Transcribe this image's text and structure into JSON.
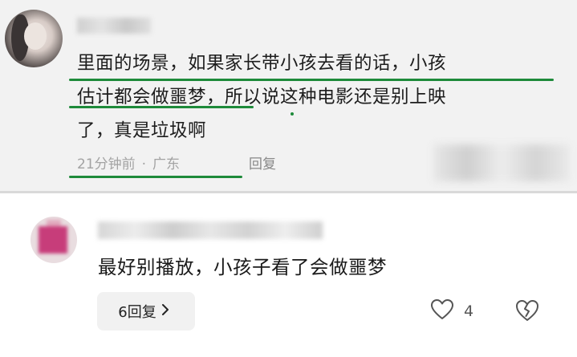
{
  "top_comment": {
    "lines": [
      "里面的场景，如果家长带小孩去看的话，小孩",
      "估计都会做噩梦，所以说这种电影还是别上映",
      "了，真是垃圾啊"
    ],
    "time": "21分钟前",
    "location": "广东",
    "reply_label": "回复",
    "underline_color": "#1e8a3a"
  },
  "bottom_comment": {
    "text": "最好别播放，小孩子看了会做噩梦",
    "replies_label": "6回复",
    "likes": "4"
  },
  "icons": {
    "like": "heart-icon",
    "dislike": "broken-heart-icon",
    "expand": "chevron-right-icon"
  }
}
